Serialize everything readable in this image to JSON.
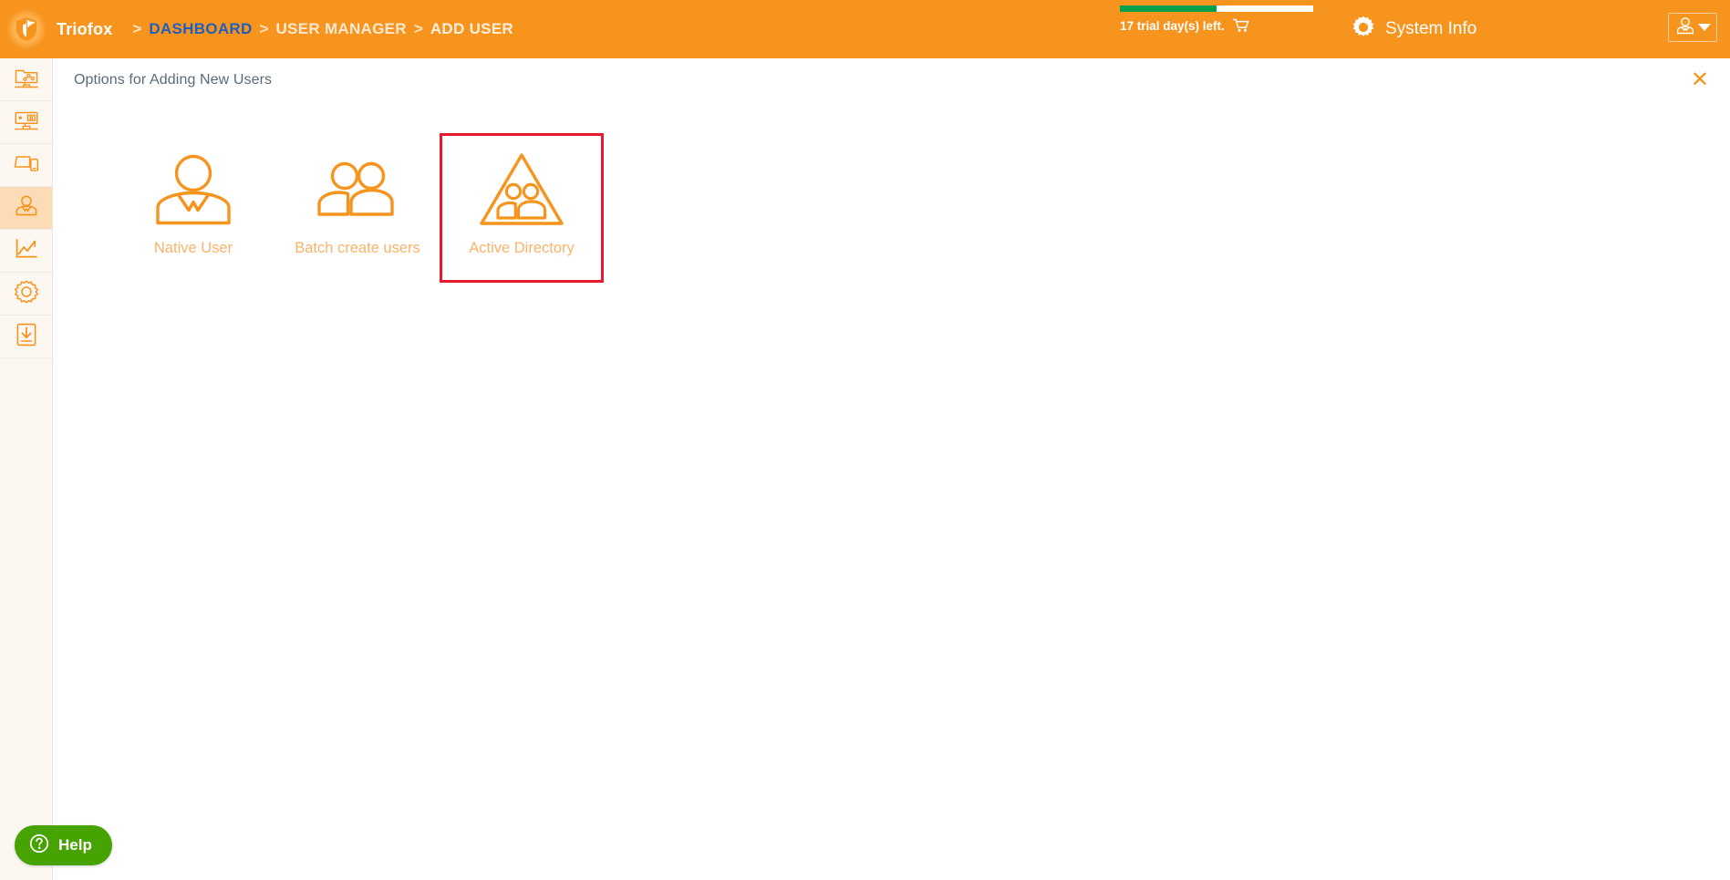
{
  "header": {
    "logo_icon": "shield-logo-icon",
    "brand": "Triofox",
    "separator": ">",
    "breadcrumbs": [
      {
        "label": "DASHBOARD",
        "state": "link"
      },
      {
        "label": "USER MANAGER",
        "state": "muted"
      },
      {
        "label": "ADD USER",
        "state": "current"
      }
    ],
    "trial": {
      "text": "17 trial day(s) left.",
      "progress_percent": 50,
      "fill_color": "#00a04c",
      "track_color": "#ffffff",
      "cart_icon": "shopping-cart-icon"
    },
    "system_info": {
      "icon": "gear-icon",
      "label": "System Info"
    },
    "user_menu": {
      "avatar_icon": "user-avatar-icon",
      "caret_icon": "chevron-down-icon"
    },
    "background_color": "#f7941e"
  },
  "sidebar": {
    "background_color": "#fdf7f2",
    "active_background_color": "#fbdcb6",
    "items": [
      {
        "icon": "shared-folder-network-icon",
        "active": false
      },
      {
        "icon": "server-monitor-icon",
        "active": false
      },
      {
        "icon": "devices-icon",
        "active": false
      },
      {
        "icon": "user-manager-icon",
        "active": true
      },
      {
        "icon": "reports-chart-icon",
        "active": false
      },
      {
        "icon": "settings-gear-icon",
        "active": false
      },
      {
        "icon": "download-icon",
        "active": false
      }
    ]
  },
  "main": {
    "panel_title": "Options for Adding New Users",
    "close_icon": "close-icon",
    "accent_color": "#f7941e",
    "selection_color": "#e8192c",
    "options": [
      {
        "label": "Native User",
        "icon": "single-user-icon",
        "selected": false
      },
      {
        "label": "Batch create users",
        "icon": "two-users-icon",
        "selected": false
      },
      {
        "label": "Active Directory",
        "icon": "active-directory-triangle-icon",
        "selected": true
      }
    ]
  },
  "help": {
    "label": "Help",
    "icon": "question-mark-circle-icon",
    "color": "#46a302"
  }
}
